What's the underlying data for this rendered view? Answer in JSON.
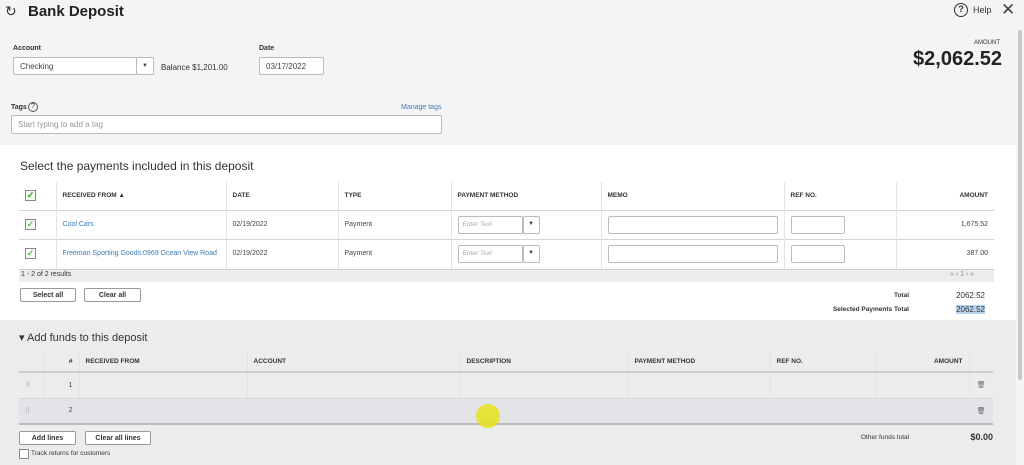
{
  "header": {
    "title": "Bank Deposit",
    "help": "Help",
    "amount_label": "AMOUNT",
    "amount": "$2,062.52"
  },
  "form": {
    "account_label": "Account",
    "account_value": "Checking",
    "balance": "Balance $1,201.00",
    "date_label": "Date",
    "date_value": "03/17/2022",
    "tags_label": "Tags",
    "manage_tags": "Manage tags",
    "tags_placeholder": "Start typing to add a tag"
  },
  "payments": {
    "heading": "Select the payments included in this deposit",
    "columns": [
      "RECEIVED FROM ▲",
      "DATE",
      "TYPE",
      "PAYMENT METHOD",
      "MEMO",
      "REF NO.",
      "AMOUNT"
    ],
    "rows": [
      {
        "from": "Cool Cars",
        "date": "02/19/2022",
        "type": "Payment",
        "method_placeholder": "Enter Text",
        "amount": "1,675.52"
      },
      {
        "from": "Freeman Sporting Goods:0969 Ocean View Road",
        "date": "02/19/2022",
        "type": "Payment",
        "method_placeholder": "Enter Text",
        "amount": "387.00"
      }
    ],
    "results": "1 - 2 of 2 results",
    "pager": "« ‹ 1 › »",
    "select_all": "Select all",
    "clear_all": "Clear all",
    "total_label": "Total",
    "total": "2062.52",
    "selected_label": "Selected Payments Total",
    "selected_total": "2062.52"
  },
  "funds": {
    "heading": "Add funds to this deposit",
    "columns": [
      "#",
      "RECEIVED FROM",
      "ACCOUNT",
      "DESCRIPTION",
      "PAYMENT METHOD",
      "REF NO.",
      "AMOUNT"
    ],
    "rows": [
      "1",
      "2"
    ],
    "add_lines": "Add lines",
    "clear_lines": "Clear all lines",
    "other_label": "Other funds total",
    "other_total": "$0.00",
    "track_returns": "Track returns for customers"
  }
}
